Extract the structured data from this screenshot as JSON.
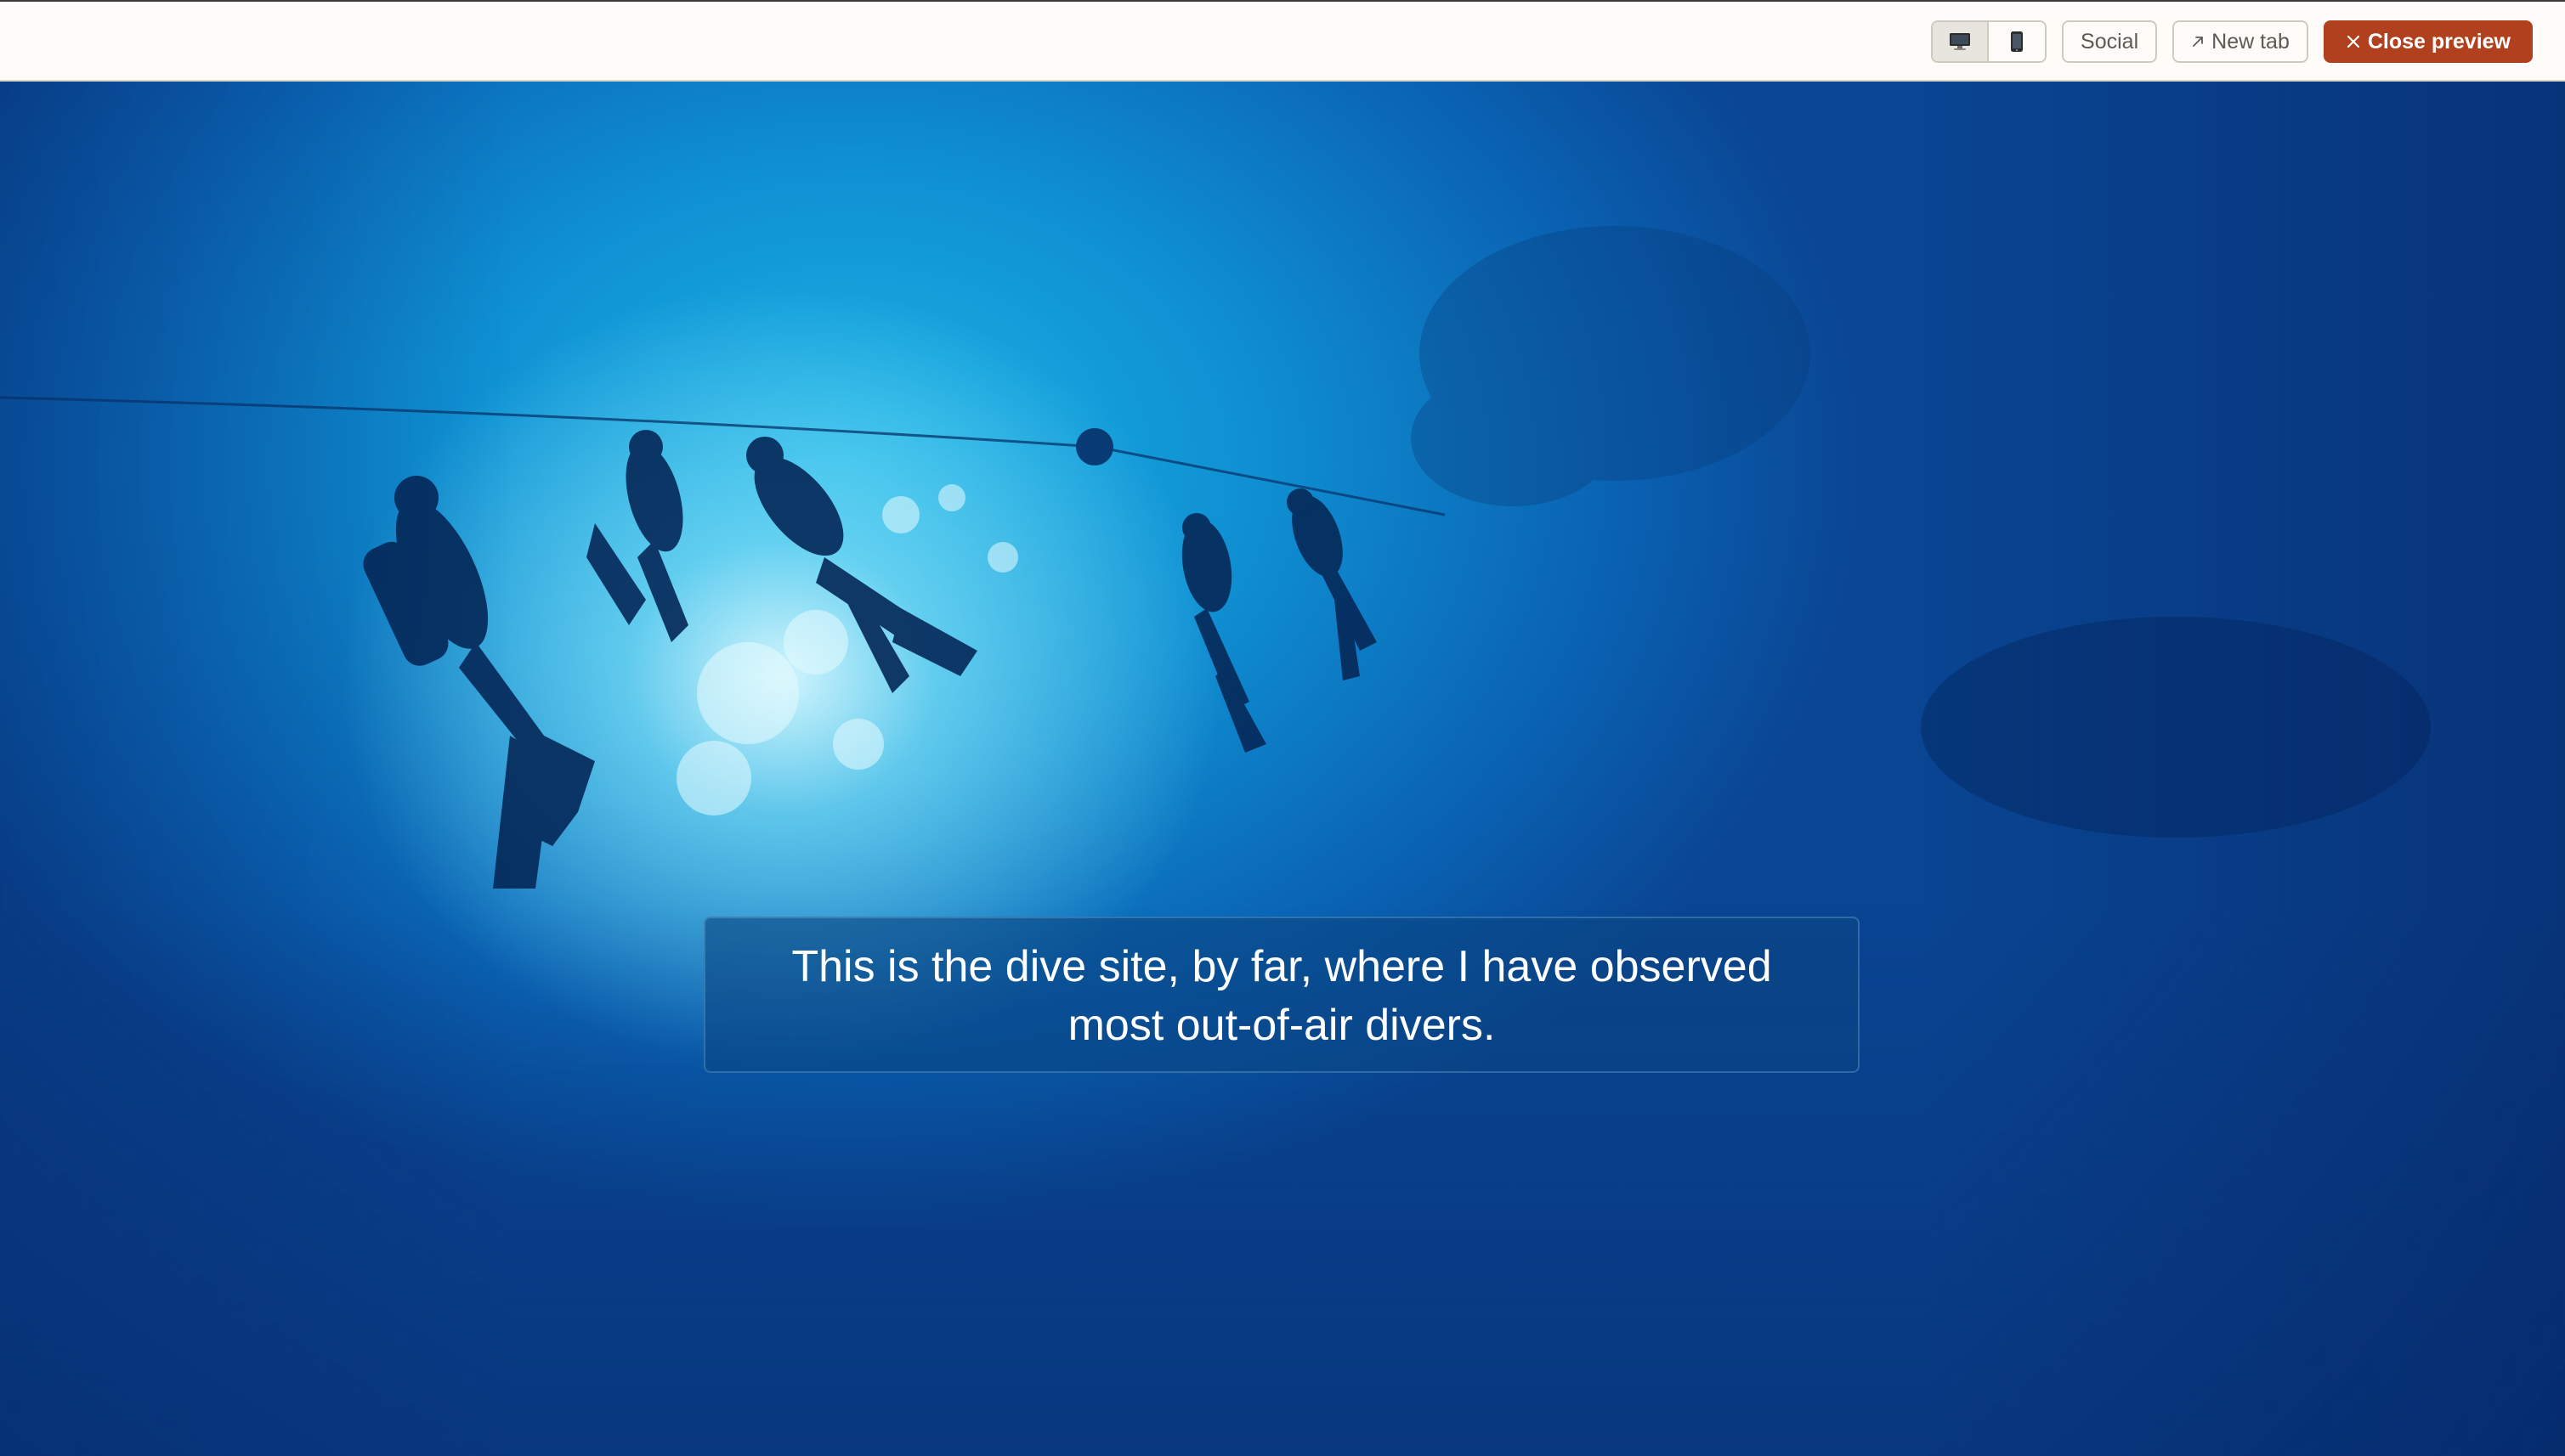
{
  "toolbar": {
    "desktop_icon": "desktop-monitor-icon",
    "mobile_icon": "mobile-phone-icon",
    "social_label": "Social",
    "new_tab_icon": "arrow-up-right-icon",
    "new_tab_label": "New tab",
    "close_icon": "close-x-icon",
    "close_label": "Close preview"
  },
  "preview": {
    "caption": "This is the dive site, by far, where I have observed most out-of-air divers."
  },
  "colors": {
    "topbar_bg": "#fdfcf8",
    "close_button": "#b1401f",
    "water_light": "#1ab3e6",
    "water_deep": "#0a4593"
  }
}
